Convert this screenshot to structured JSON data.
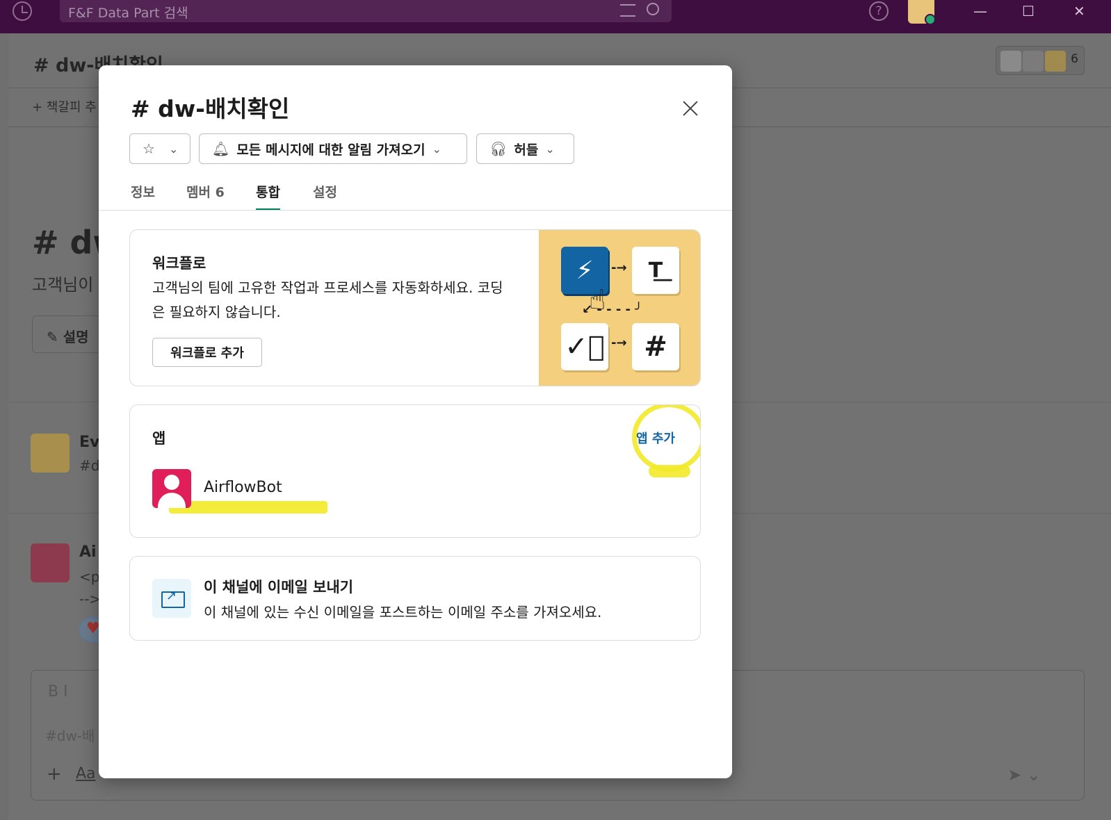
{
  "titlebar": {
    "search_placeholder": "F&F Data Part 검색",
    "help_label": "?",
    "minimize": "—",
    "maximize": "☐",
    "close": "✕"
  },
  "background": {
    "channel_header": "# dw-배치확인 ⌄",
    "member_count": "6",
    "bookmark": "+ 책갈피 추",
    "channel_big": "# dw",
    "channel_sub": "고객님이",
    "describe_button": "✎ 설명",
    "msg1_name": "Ev",
    "msg1_text": "#d",
    "msg2_name": "Ai",
    "msg2_text1": "<p",
    "msg2_text2": "-->",
    "composer_format": "B   I",
    "composer_placeholder": "#dw-배",
    "composer_plus": "+",
    "composer_aa": "Aa",
    "composer_send": "➤ ⌄"
  },
  "modal": {
    "title": "# dw-배치확인",
    "star_chevron": "⌄",
    "notify_label": "모든 메시지에 대한 알림 가져오기",
    "huddle_label": "허들",
    "tabs": [
      {
        "label": "정보"
      },
      {
        "label": "멤버 6"
      },
      {
        "label": "통합"
      },
      {
        "label": "설정"
      }
    ],
    "workflow": {
      "heading": "워크플로",
      "description": "고객님의 팀에 고유한 작업과 프로세스를 자동화하세요. 코딩은 필요하지 않습니다.",
      "add_button": "워크플로 추가"
    },
    "apps": {
      "heading": "앱",
      "add_link": "앱 추가",
      "items": [
        {
          "name": "AirflowBot"
        }
      ]
    },
    "email": {
      "heading": "이 채널에 이메일 보내기",
      "description": "이 채널에 있는 수신 이메일을 포스트하는 이메일 주소를 가져오세요."
    }
  },
  "colors": {
    "titlebar": "#3f0e40",
    "link": "#1264a3",
    "active_tab": "#007a5a",
    "workflow_art_bg": "#f3cf7e",
    "bot_avatar": "#e01e5a",
    "highlighter": "#f2ea2a"
  }
}
